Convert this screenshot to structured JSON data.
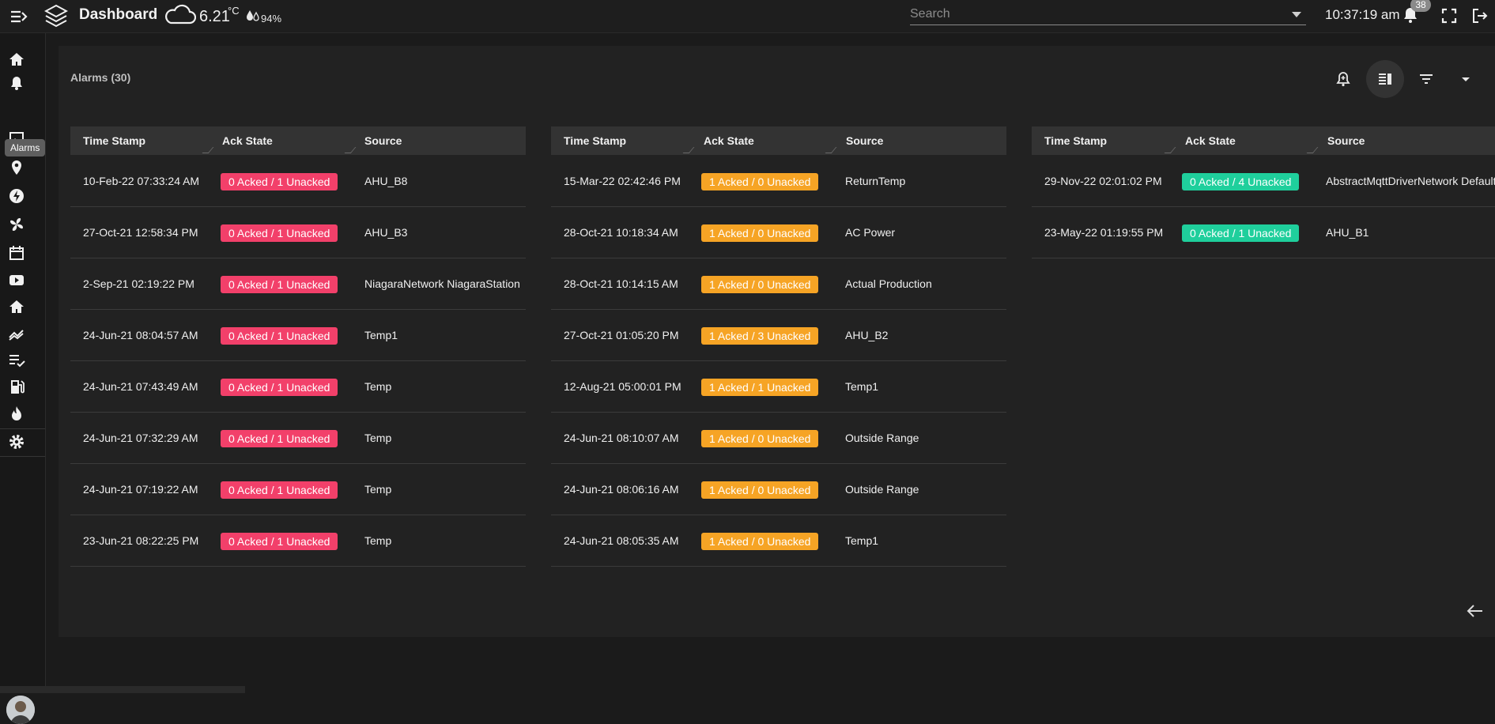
{
  "header": {
    "title": "Dashboard",
    "weather": {
      "temperature": "6.21",
      "unit": "°C",
      "humidity": "94%"
    },
    "search": {
      "placeholder": "Search",
      "value": ""
    },
    "clock": "10:37:19 am",
    "notifications_count": "38",
    "icons": [
      "menu-icon",
      "layers-logo-icon",
      "cloud-icon",
      "droplets-icon",
      "bell-icon",
      "fullscreen-icon",
      "logout-icon"
    ]
  },
  "sidebar": {
    "tooltip": "Alarms",
    "items": [
      "home-icon",
      "bell-icon",
      "image-icon",
      "location-pin-icon",
      "lightning-icon",
      "fan-icon",
      "calendar-icon",
      "video-icon",
      "home-icon",
      "trend-icon",
      "checklist-icon",
      "fuel-icon",
      "flame-icon",
      "gear-icon"
    ]
  },
  "card": {
    "title": "Alarms (30)",
    "toolbar": [
      "alarm-add-icon",
      "split-view-icon",
      "filter-icon",
      "dropdown-icon"
    ]
  },
  "columns": [
    "Time Stamp",
    "Ack State",
    "Source"
  ],
  "tables": [
    {
      "badge_color": "#f2406a",
      "rows": [
        {
          "time": "10-Feb-22 07:33:24 AM",
          "ack": "0 Acked / 1 Unacked",
          "source": "AHU_B8"
        },
        {
          "time": "27-Oct-21 12:58:34 PM",
          "ack": "0 Acked / 1 Unacked",
          "source": "AHU_B3"
        },
        {
          "time": "2-Sep-21 02:19:22 PM",
          "ack": "0 Acked / 1 Unacked",
          "source": "NiagaraNetwork NiagaraStation"
        },
        {
          "time": "24-Jun-21 08:04:57 AM",
          "ack": "0 Acked / 1 Unacked",
          "source": "Temp1"
        },
        {
          "time": "24-Jun-21 07:43:49 AM",
          "ack": "0 Acked / 1 Unacked",
          "source": "Temp"
        },
        {
          "time": "24-Jun-21 07:32:29 AM",
          "ack": "0 Acked / 1 Unacked",
          "source": "Temp"
        },
        {
          "time": "24-Jun-21 07:19:22 AM",
          "ack": "0 Acked / 1 Unacked",
          "source": "Temp"
        },
        {
          "time": "23-Jun-21 08:22:25 PM",
          "ack": "0 Acked / 1 Unacked",
          "source": "Temp"
        }
      ]
    },
    {
      "badge_color": "#f6a425",
      "rows": [
        {
          "time": "15-Mar-22 02:42:46 PM",
          "ack": "1 Acked / 0 Unacked",
          "source": "ReturnTemp"
        },
        {
          "time": "28-Oct-21 10:18:34 AM",
          "ack": "1 Acked / 0 Unacked",
          "source": "AC Power"
        },
        {
          "time": "28-Oct-21 10:14:15 AM",
          "ack": "1 Acked / 0 Unacked",
          "source": "Actual Production"
        },
        {
          "time": "27-Oct-21 01:05:20 PM",
          "ack": "1 Acked / 3 Unacked",
          "source": "AHU_B2"
        },
        {
          "time": "12-Aug-21 05:00:01 PM",
          "ack": "1 Acked / 1 Unacked",
          "source": "Temp1"
        },
        {
          "time": "24-Jun-21 08:10:07 AM",
          "ack": "1 Acked / 0 Unacked",
          "source": "Outside Range"
        },
        {
          "time": "24-Jun-21 08:06:16 AM",
          "ack": "1 Acked / 0 Unacked",
          "source": "Outside Range"
        },
        {
          "time": "24-Jun-21 08:05:35 AM",
          "ack": "1 Acked / 0 Unacked",
          "source": "Temp1"
        }
      ]
    },
    {
      "badge_color": "#1fcf9c",
      "rows": [
        {
          "time": "29-Nov-22 02:01:02 PM",
          "ack": "0 Acked / 4 Unacked",
          "source": "AbstractMqttDriverNetwork Default"
        },
        {
          "time": "23-May-22 01:19:55 PM",
          "ack": "0 Acked / 1 Unacked",
          "source": "AHU_B1"
        }
      ]
    }
  ],
  "colors": {
    "accent_red": "#f2406a",
    "accent_orange": "#f6a425",
    "accent_green": "#1fcf9c",
    "background": "#1b1b1b",
    "card": "#222222"
  }
}
